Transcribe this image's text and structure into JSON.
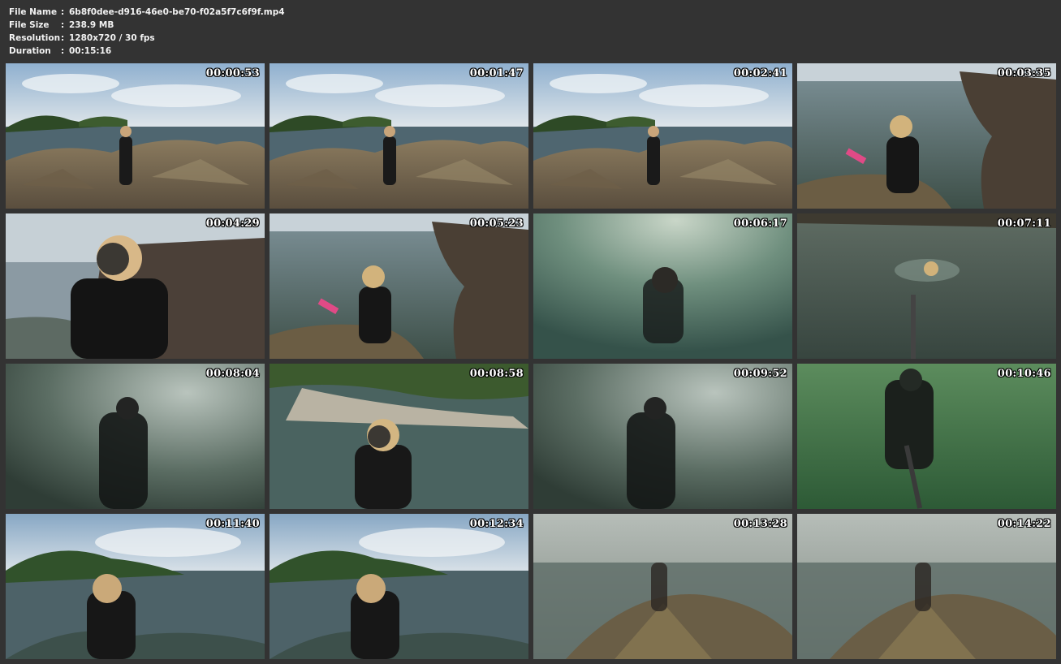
{
  "file_info": {
    "file_name": {
      "label": "File Name",
      "value": "6b8f0dee-d916-46e0-be70-f02a5f7c6f9f.mp4"
    },
    "file_size": {
      "label": "File Size",
      "value": "238.9 MB"
    },
    "resolution": {
      "label": "Resolution",
      "value": "1280x720 / 30 fps"
    },
    "duration": {
      "label": "Duration",
      "value": "00:15:16"
    },
    "separator": ":"
  },
  "thumbnails": [
    {
      "timestamp": "00:00:53",
      "scene": "coast"
    },
    {
      "timestamp": "00:01:47",
      "scene": "coast"
    },
    {
      "timestamp": "00:02:41",
      "scene": "coast"
    },
    {
      "timestamp": "00:03:35",
      "scene": "rocks-water"
    },
    {
      "timestamp": "00:04:29",
      "scene": "rocks-closeup"
    },
    {
      "timestamp": "00:05:23",
      "scene": "rocks-water"
    },
    {
      "timestamp": "00:06:17",
      "scene": "underwater-light"
    },
    {
      "timestamp": "00:07:11",
      "scene": "surface-swim"
    },
    {
      "timestamp": "00:08:04",
      "scene": "underwater-murky"
    },
    {
      "timestamp": "00:08:58",
      "scene": "shallow-shore"
    },
    {
      "timestamp": "00:09:52",
      "scene": "underwater-murky"
    },
    {
      "timestamp": "00:10:46",
      "scene": "underwater-green"
    },
    {
      "timestamp": "00:11:40",
      "scene": "coast-water"
    },
    {
      "timestamp": "00:12:34",
      "scene": "coast-water"
    },
    {
      "timestamp": "00:13:28",
      "scene": "foggy-rocks"
    },
    {
      "timestamp": "00:14:22",
      "scene": "foggy-rocks"
    }
  ],
  "colors": {
    "background": "#333333",
    "header_text": "#f2f2f2",
    "timestamp_text": "#ffffff"
  }
}
